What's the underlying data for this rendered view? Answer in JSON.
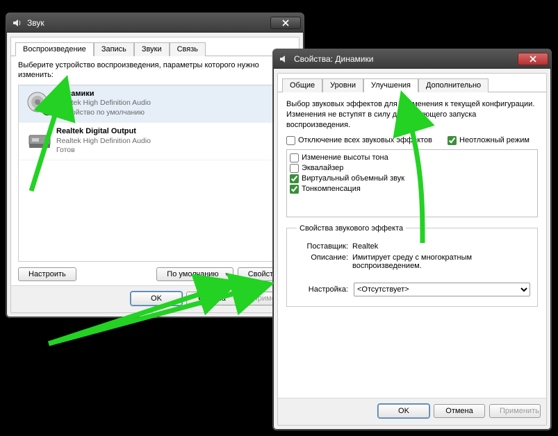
{
  "sound_window": {
    "title": "Звук",
    "tabs": [
      "Воспроизведение",
      "Запись",
      "Звуки",
      "Связь"
    ],
    "active_tab": 0,
    "instruction": "Выберите устройство воспроизведения, параметры которого нужно изменить:",
    "devices": [
      {
        "name": "Динамики",
        "driver": "Realtek High Definition Audio",
        "status": "Устройство по умолчанию",
        "default": true
      },
      {
        "name": "Realtek Digital Output",
        "driver": "Realtek High Definition Audio",
        "status": "Готов",
        "default": false
      }
    ],
    "buttons": {
      "configure": "Настроить",
      "set_default": "По умолчанию",
      "properties": "Свойства",
      "ok": "OK",
      "cancel": "Отмена",
      "apply": "Применить"
    }
  },
  "props_window": {
    "title": "Свойства: Динамики",
    "tabs": [
      "Общие",
      "Уровни",
      "Улучшения",
      "Дополнительно"
    ],
    "active_tab": 2,
    "description": "Выбор звуковых эффектов для применения к текущей конфигурации. Изменения не вступят в силу до следующего запуска воспроизведения.",
    "disable_all_label": "Отключение всех звуковых эффектов",
    "disable_all_checked": false,
    "immediate_label": "Неотложный режим",
    "immediate_checked": true,
    "effects": [
      {
        "label": "Изменение высоты тона",
        "checked": false
      },
      {
        "label": "Эквалайзер",
        "checked": false
      },
      {
        "label": "Виртуальный объемный звук",
        "checked": true
      },
      {
        "label": "Тонкомпенсация",
        "checked": true
      }
    ],
    "group_title": "Свойства звукового эффекта",
    "vendor_label": "Поставщик:",
    "vendor_value": "Realtek",
    "desc_label": "Описание:",
    "desc_value": "Имитирует среду с многократным воспроизведением.",
    "config_label": "Настройка:",
    "config_value": "<Отсутствует>",
    "buttons": {
      "ok": "OK",
      "cancel": "Отмена",
      "apply": "Применить"
    }
  }
}
